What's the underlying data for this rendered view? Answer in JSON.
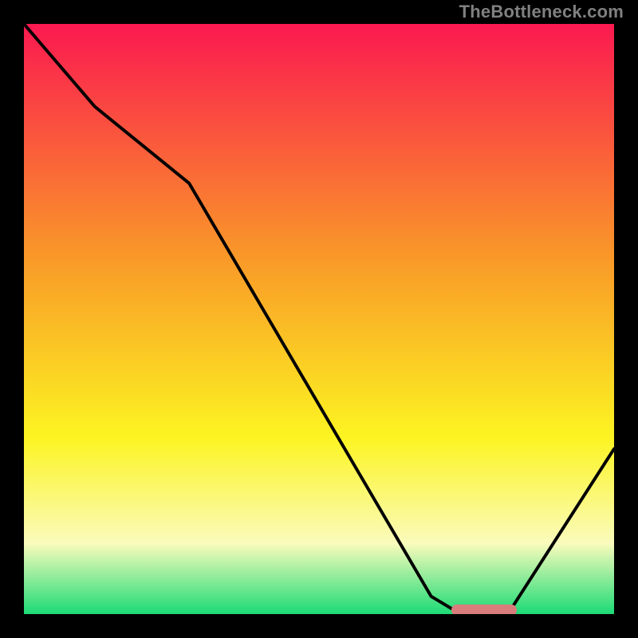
{
  "attribution": "TheBottleneck.com",
  "colors": {
    "top": "#fb1950",
    "mid_orange": "#f99a28",
    "mid_yellow": "#fcf421",
    "pale_yellow": "#fafbbc",
    "green": "#1cdb76",
    "marker": "#d97c7c",
    "line": "#000000"
  },
  "chart_data": {
    "type": "line",
    "title": "",
    "xlabel": "",
    "ylabel": "",
    "xlim": [
      0,
      100
    ],
    "ylim": [
      0,
      100
    ],
    "x": [
      0,
      12,
      28,
      69,
      74,
      82,
      100
    ],
    "values": [
      100,
      86,
      73,
      3,
      0,
      0,
      28
    ],
    "optimum_range_x": [
      72,
      83
    ],
    "gradient_stops": [
      {
        "offset": 0,
        "color": "#fb1950"
      },
      {
        "offset": 40,
        "color": "#f99a28"
      },
      {
        "offset": 70,
        "color": "#fcf421"
      },
      {
        "offset": 88,
        "color": "#fafbbc"
      },
      {
        "offset": 100,
        "color": "#1cdb76"
      }
    ]
  }
}
